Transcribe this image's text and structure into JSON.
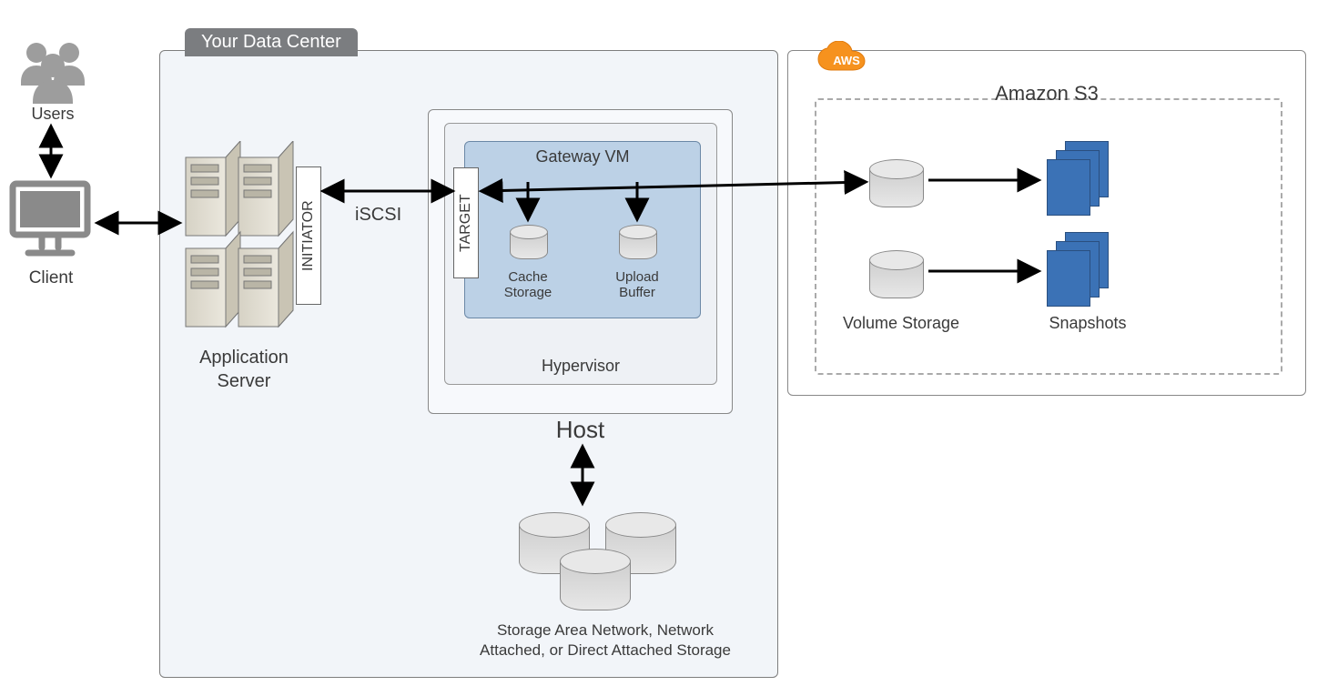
{
  "users_label": "Users",
  "client_label": "Client",
  "datacenter_tab": "Your Data Center",
  "app_server_label": "Application\nServer",
  "initiator_label": "INITIATOR",
  "target_label": "TARGET",
  "iscsi_label": "iSCSI",
  "gateway_vm_label": "Gateway VM",
  "cache_storage_label": "Cache\nStorage",
  "upload_buffer_label": "Upload\nBuffer",
  "hypervisor_label": "Hypervisor",
  "host_label": "Host",
  "san_label": "Storage Area Network, Network\nAttached, or Direct Attached Storage",
  "aws_badge": "AWS",
  "amazon_s3_label": "Amazon S3",
  "volume_storage_label": "Volume Storage",
  "snapshots_label": "Snapshots"
}
